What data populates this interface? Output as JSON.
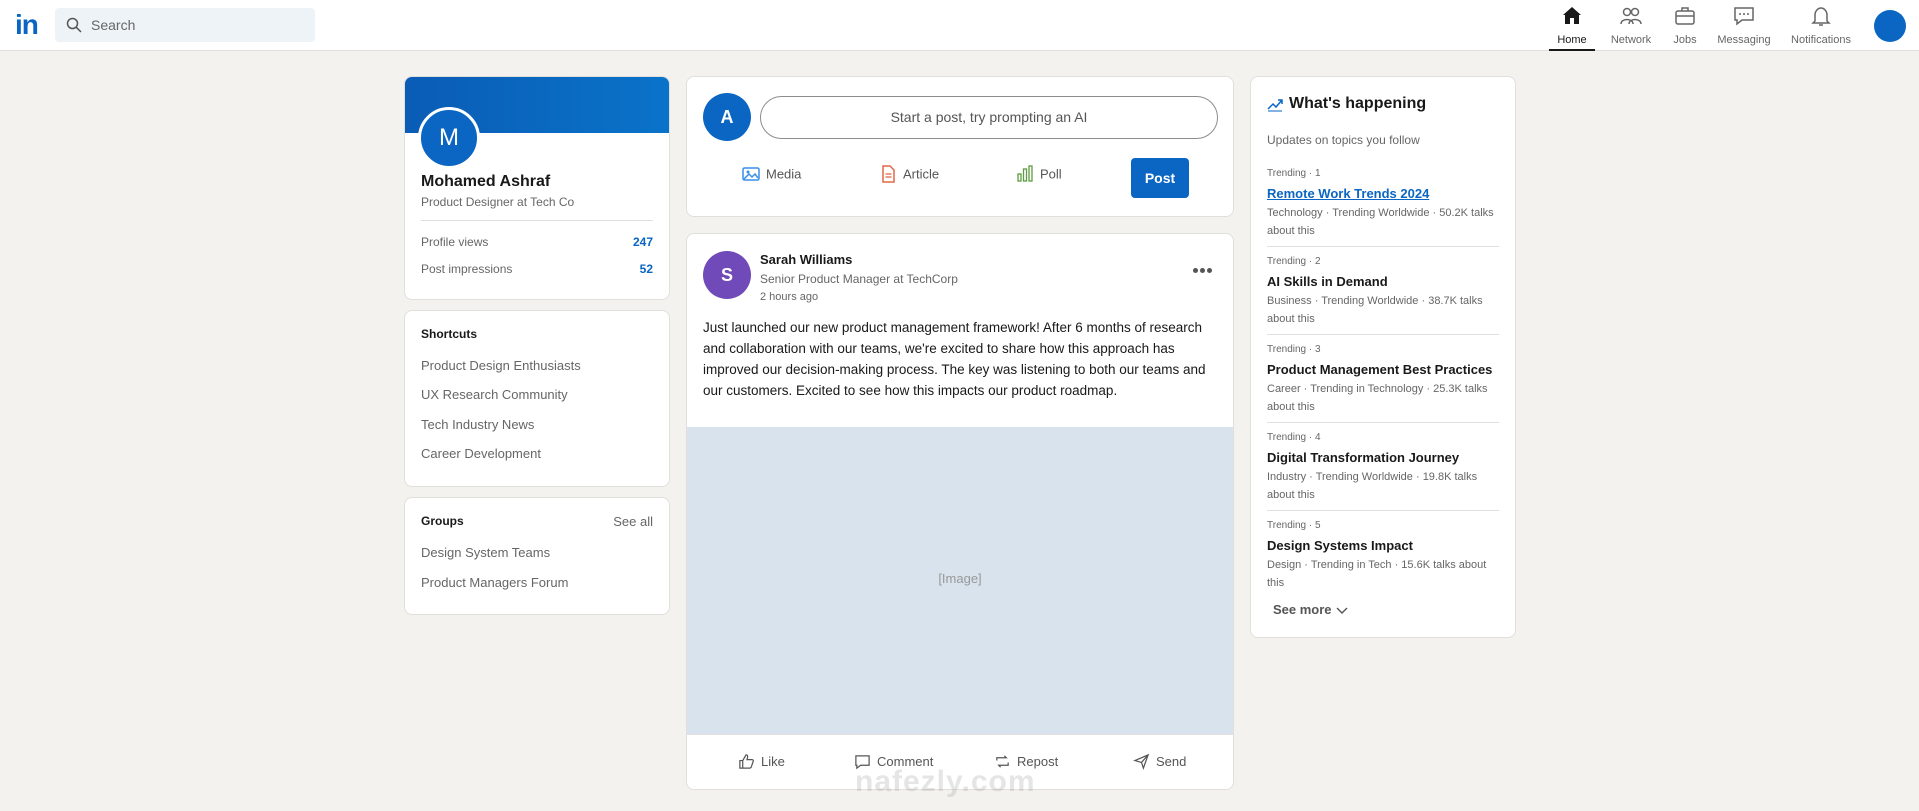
{
  "nav": {
    "logo": "in",
    "search_placeholder": "Search",
    "items": [
      {
        "label": "Home",
        "icon": "home-icon",
        "active": true
      },
      {
        "label": "Network",
        "icon": "network-icon"
      },
      {
        "label": "Jobs",
        "icon": "briefcase-icon"
      },
      {
        "label": "Messaging",
        "icon": "message-icon"
      },
      {
        "label": "Notifications",
        "icon": "bell-icon"
      }
    ]
  },
  "profile": {
    "initial": "M",
    "name": "Mohamed Ashraf",
    "title": "Product Designer at Tech Co",
    "stats": [
      {
        "label": "Profile views",
        "value": "247"
      },
      {
        "label": "Post impressions",
        "value": "52"
      }
    ]
  },
  "shortcuts": {
    "title": "Shortcuts",
    "items": [
      "Product Design Enthusiasts",
      "UX Research Community",
      "Tech Industry News",
      "Career Development"
    ]
  },
  "groups": {
    "title": "Groups",
    "see_all": "See all",
    "items": [
      "Design System Teams",
      "Product Managers Forum"
    ]
  },
  "composer": {
    "initial": "A",
    "placeholder": "Start a post, try prompting an AI",
    "actions": [
      "Media",
      "Article",
      "Poll"
    ],
    "post_label": "Post"
  },
  "post": {
    "initial": "S",
    "author": "Sarah Williams",
    "author_title": "Senior Product Manager at TechCorp",
    "time": "2 hours ago",
    "text": "Just launched our new product management framework! After 6 months of research and collaboration with our teams, we're excited to share how this approach has improved our decision-making process. The key was listening to both our teams and our customers. Excited to see how this impacts our product roadmap.",
    "image_placeholder": "[Image]",
    "actions": [
      "Like",
      "Comment",
      "Repost",
      "Send"
    ]
  },
  "happening": {
    "title": "What's happening",
    "subtitle": "Updates on topics you follow",
    "trends": [
      {
        "rank": "Trending · 1",
        "topic": "Remote Work Trends 2024",
        "meta": "Technology · Trending Worldwide · 50.2K talks about this"
      },
      {
        "rank": "Trending · 2",
        "topic": "AI Skills in Demand",
        "meta": "Business · Trending Worldwide · 38.7K talks about this"
      },
      {
        "rank": "Trending · 3",
        "topic": "Product Management Best Practices",
        "meta": "Career · Trending in Technology · 25.3K talks about this"
      },
      {
        "rank": "Trending · 4",
        "topic": "Digital Transformation Journey",
        "meta": "Industry · Trending Worldwide · 19.8K talks about this"
      },
      {
        "rank": "Trending · 5",
        "topic": "Design Systems Impact",
        "meta": "Design · Trending in Tech · 15.6K talks about this"
      }
    ],
    "see_more": "See more"
  },
  "watermark": "nafezly.com",
  "colors": {
    "accent": "#0a66c2",
    "background": "#f4f2ee"
  }
}
